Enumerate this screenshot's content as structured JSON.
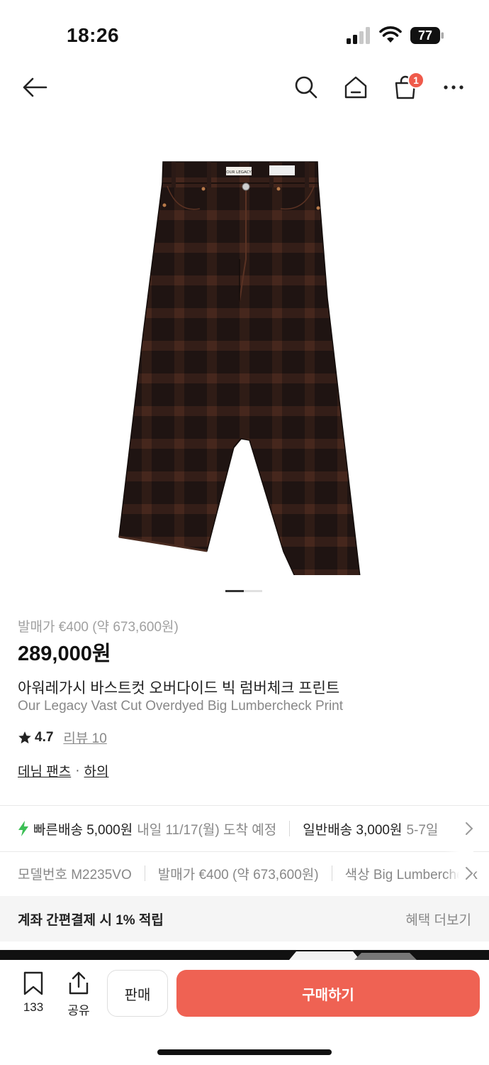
{
  "status_bar": {
    "time": "18:26",
    "battery": "77"
  },
  "nav": {
    "icons": [
      "back-arrow-icon",
      "search-icon",
      "home-icon",
      "shopping-bag-icon",
      "more-icon"
    ],
    "cart_count": "1"
  },
  "product": {
    "image_count": 2,
    "active_image": 1,
    "brand_label": "OUR LEGACY",
    "release_price": "발매가 €400 (약 673,600원)",
    "price": "289,000원",
    "name_ko": "아워레가시 바스트컷 오버다이드 빅 럼버체크 프린트",
    "name_en": "Our Legacy Vast Cut Overdyed Big Lumbercheck Print",
    "rating": "4.7",
    "review_label": "리뷰 10",
    "category_main": "데님 팬츠",
    "category_separator": "·",
    "category_sub": "하의"
  },
  "shipping": {
    "express_label": "빠른배송 5,000원",
    "express_eta": "내일 11/17(월) 도착 예정",
    "standard_label": "일반배송 3,000원",
    "standard_eta": "5-7일"
  },
  "info": {
    "model": "모델번호 M2235VO",
    "release": "발매가 €400 (약 673,600원)",
    "color": "색상 Big Lumbercheck"
  },
  "benefit": {
    "text": "계좌 간편결제 시 1% 적립",
    "more": "혜택 더보기"
  },
  "bottom_bar": {
    "bookmark_count": "133",
    "share_label": "공유",
    "sell_label": "판매",
    "buy_label": "구매하기"
  },
  "colors": {
    "accent": "#ef6253",
    "badge": "#ef5a4b",
    "express": "#3cbf55"
  }
}
